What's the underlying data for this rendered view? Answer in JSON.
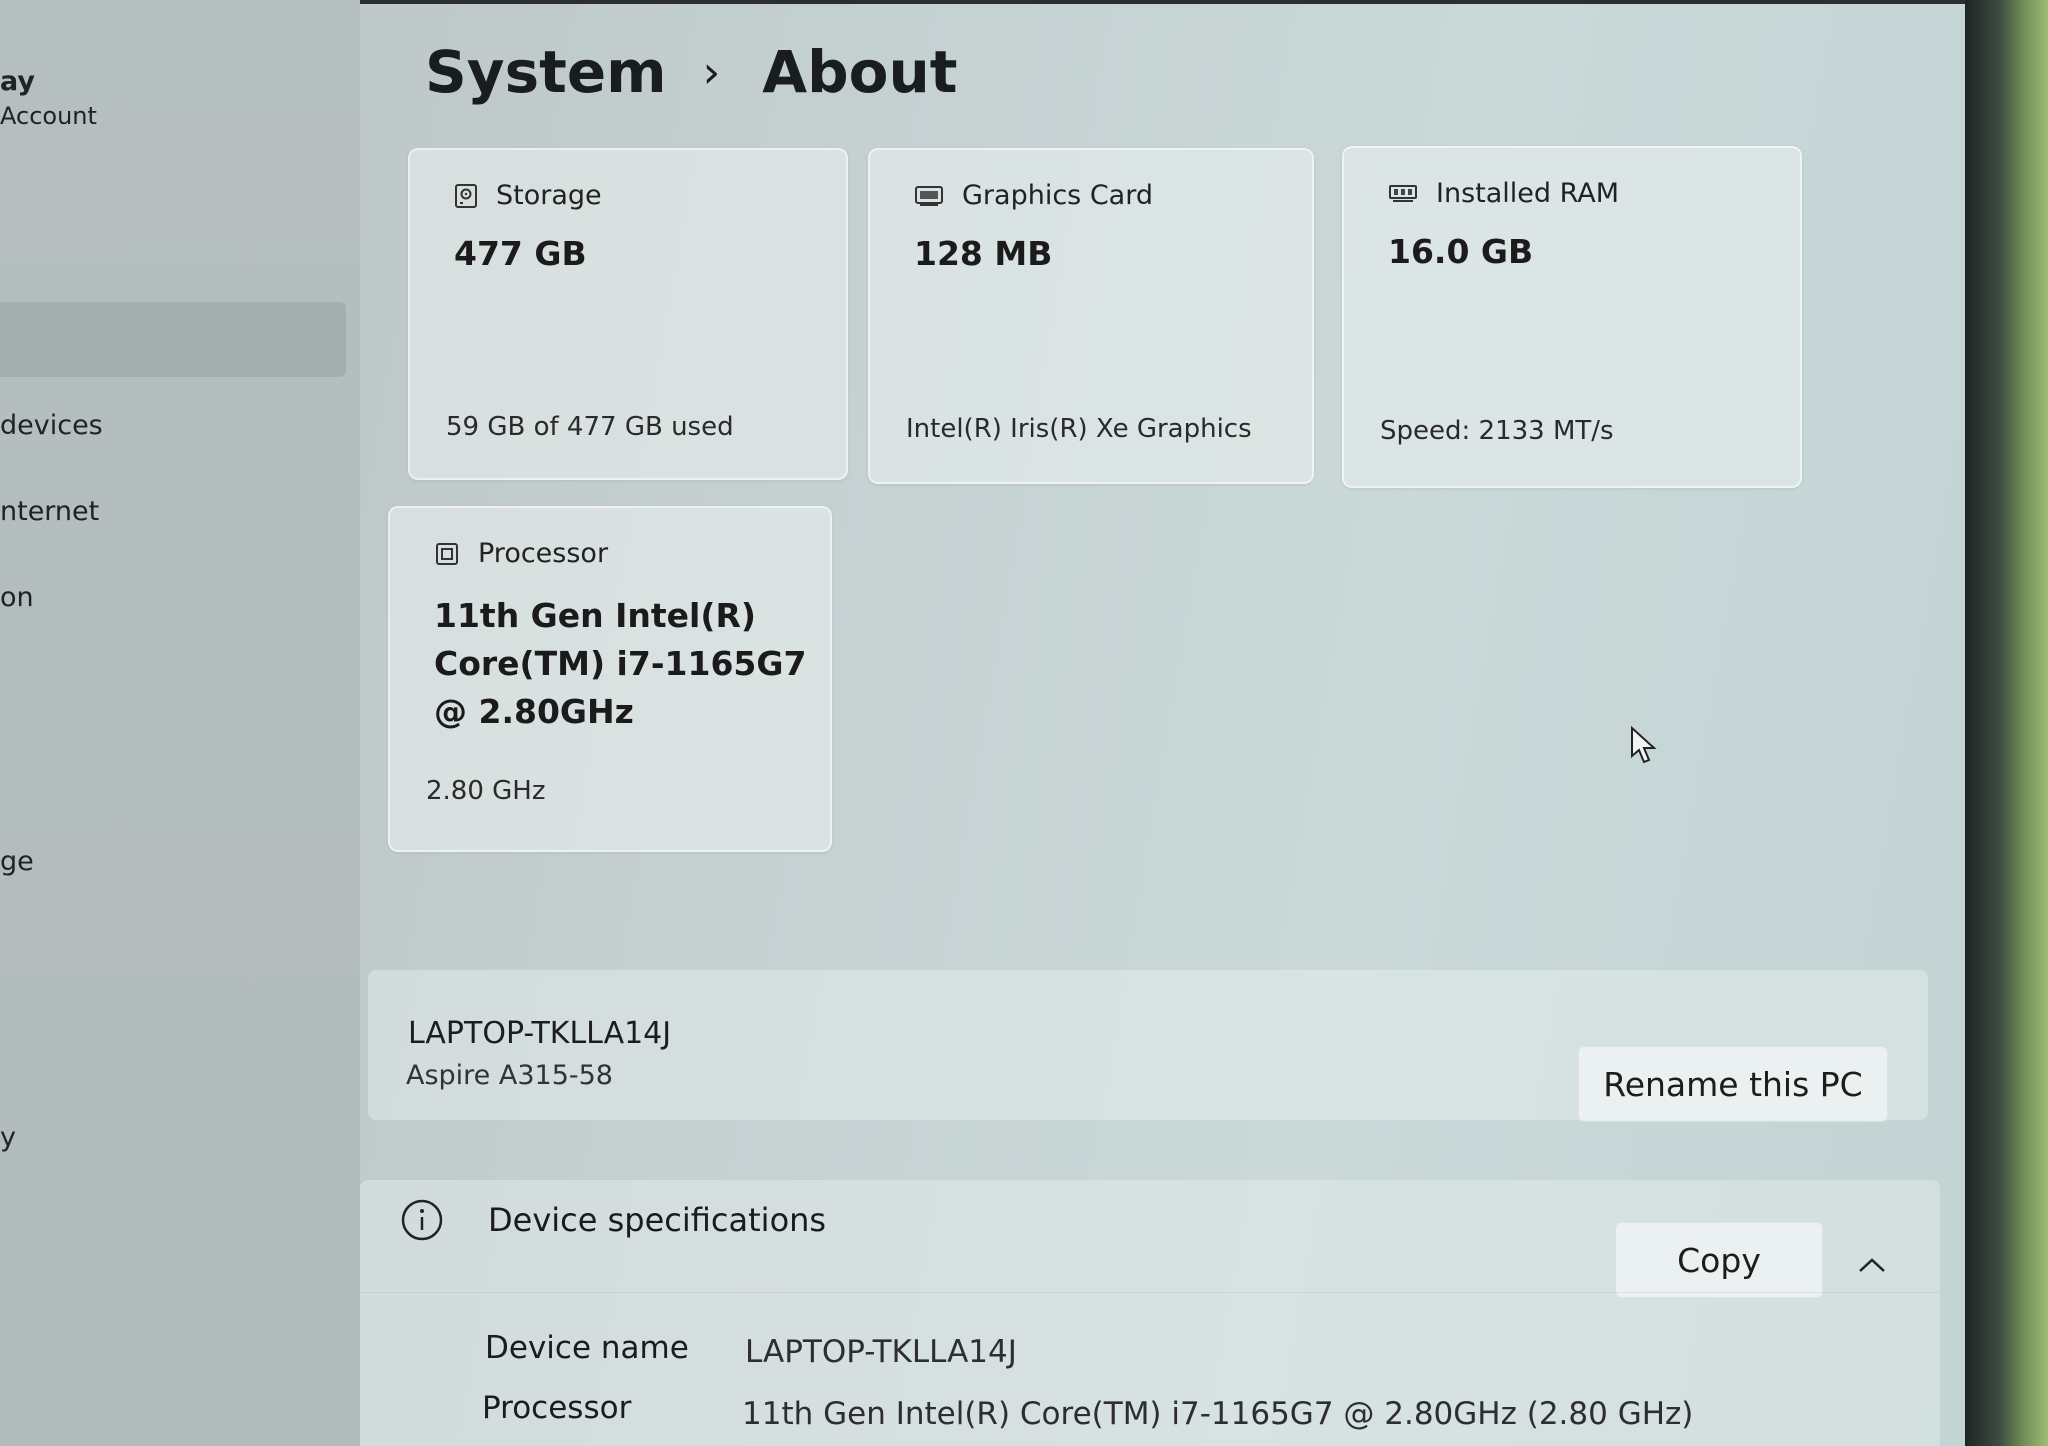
{
  "sidebar": {
    "items": [
      {
        "label": "ay"
      },
      {
        "label": "Account"
      },
      {
        "label": "devices"
      },
      {
        "label": "nternet"
      },
      {
        "label": "on"
      },
      {
        "label": "ge"
      },
      {
        "label": "y"
      }
    ]
  },
  "header": {
    "crumb_parent": "System",
    "crumb_separator": "›",
    "crumb_current": "About"
  },
  "cards": {
    "storage": {
      "title": "Storage",
      "value": "477 GB",
      "detail": "59 GB of 477 GB used",
      "icon": "storage-icon"
    },
    "graphics": {
      "title": "Graphics Card",
      "value": "128 MB",
      "detail": "Intel(R) Iris(R) Xe Graphics",
      "icon": "graphics-card-icon"
    },
    "ram": {
      "title": "Installed RAM",
      "value": "16.0 GB",
      "detail": "Speed: 2133 MT/s",
      "icon": "ram-icon"
    },
    "processor": {
      "title": "Processor",
      "value": "11th Gen Intel(R) Core(TM) i7-1165G7 @ 2.80GHz",
      "detail": "2.80 GHz",
      "icon": "processor-icon"
    }
  },
  "pc": {
    "name": "LAPTOP-TKLLA14J",
    "model": "Aspire A315-58",
    "rename_label": "Rename this PC"
  },
  "specs": {
    "title": "Device specifications",
    "copy_label": "Copy",
    "rows": [
      {
        "label": "Device name",
        "value": "LAPTOP-TKLLA14J"
      },
      {
        "label": "Processor",
        "value": "11th Gen Intel(R) Core(TM) i7-1165G7 @ 2.80GHz (2.80 GHz)"
      }
    ]
  }
}
